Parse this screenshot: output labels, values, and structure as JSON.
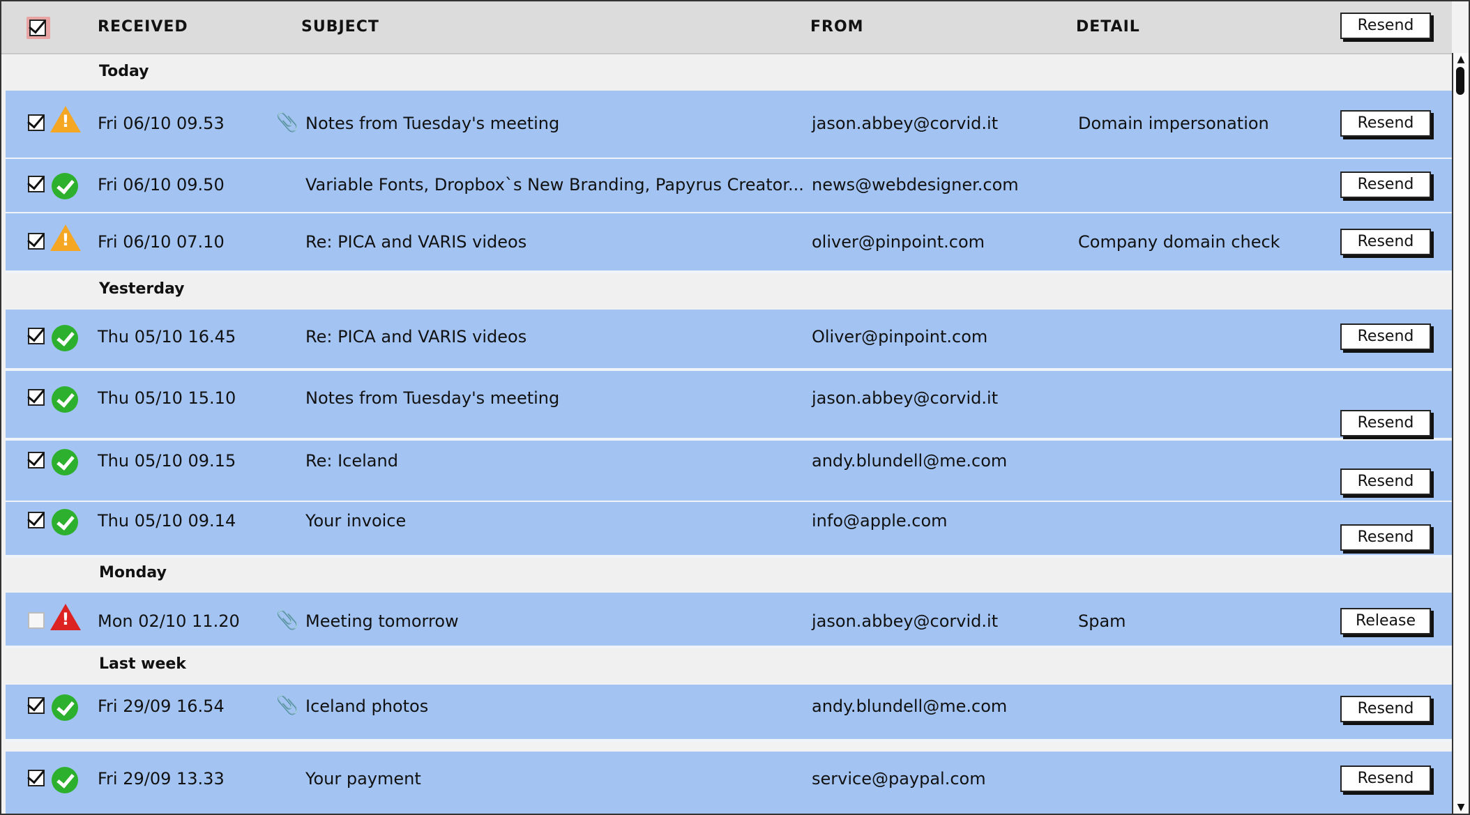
{
  "columns": {
    "received": "RECEIVED",
    "subject": "SUBJECT",
    "from": "FROM",
    "detail": "DETAIL",
    "header_button": "Resend"
  },
  "groups": [
    {
      "label": "Today"
    },
    {
      "label": "Yesterday"
    },
    {
      "label": "Monday"
    },
    {
      "label": "Last week"
    }
  ],
  "rows": [
    {
      "checked": true,
      "status": "warning-icon",
      "received": "Fri 06/10 09.53",
      "attachment": true,
      "subject": "Notes from Tuesday's meeting",
      "from": "jason.abbey@corvid.it",
      "detail": "Domain impersonation",
      "action": "Resend"
    },
    {
      "checked": true,
      "status": "ok-icon",
      "received": "Fri 06/10 09.50",
      "attachment": false,
      "subject": "Variable Fonts, Dropbox`s New Branding, Papyrus Creator...",
      "from": "news@webdesigner.com",
      "detail": "",
      "action": "Resend"
    },
    {
      "checked": true,
      "status": "warning-icon",
      "received": "Fri 06/10 07.10",
      "attachment": false,
      "subject": "Re: PICA and VARIS videos",
      "from": "oliver@pinpoint.com",
      "detail": "Company domain check",
      "action": "Resend"
    },
    {
      "checked": true,
      "status": "ok-icon",
      "received": "Thu 05/10 16.45",
      "attachment": false,
      "subject": "Re: PICA and VARIS videos",
      "from": "Oliver@pinpoint.com",
      "detail": "",
      "action": "Resend"
    },
    {
      "checked": true,
      "status": "ok-icon",
      "received": "Thu 05/10 15.10",
      "attachment": false,
      "subject": "Notes from Tuesday's meeting",
      "from": "jason.abbey@corvid.it",
      "detail": "",
      "action": "Resend"
    },
    {
      "checked": true,
      "status": "ok-icon",
      "received": "Thu 05/10 09.15",
      "attachment": false,
      "subject": "Re: Iceland",
      "from": "andy.blundell@me.com",
      "detail": "",
      "action": "Resend"
    },
    {
      "checked": true,
      "status": "ok-icon",
      "received": "Thu 05/10 09.14",
      "attachment": false,
      "subject": "Your invoice",
      "from": "info@apple.com",
      "detail": "",
      "action": "Resend"
    },
    {
      "checked": false,
      "status": "danger-icon",
      "received": "Mon 02/10 11.20",
      "attachment": true,
      "subject": "Meeting tomorrow",
      "from": "jason.abbey@corvid.it",
      "detail": "Spam",
      "action": "Release"
    },
    {
      "checked": true,
      "status": "ok-icon",
      "received": "Fri 29/09 16.54",
      "attachment": true,
      "subject": "Iceland photos",
      "from": "andy.blundell@me.com",
      "detail": "",
      "action": "Resend"
    },
    {
      "checked": true,
      "status": "ok-icon",
      "received": "Fri 29/09 13.33",
      "attachment": false,
      "subject": "Your payment",
      "from": "service@paypal.com",
      "detail": "",
      "action": "Resend"
    }
  ],
  "colors": {
    "row_bg": "#a3c4f3",
    "header_bg": "#dcdcdc",
    "ok": "#2db02d",
    "warning": "#f5a623",
    "danger": "#dd2222"
  },
  "icons": {
    "attachment": "paperclip-icon",
    "scroll_up": "arrow-up-icon",
    "scroll_down": "arrow-down-icon"
  }
}
